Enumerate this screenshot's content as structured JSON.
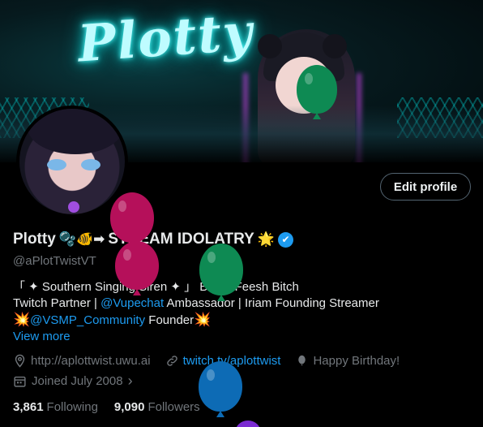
{
  "banner": {
    "neon_text": "Plotty"
  },
  "profile": {
    "edit_label": "Edit profile",
    "name": "Plotty",
    "name_emoji": "🫧🐠➡",
    "name_suffix": "STREAM IDOLATRY",
    "name_suffix_emoji": "🌟",
    "verified_mark": "✔",
    "handle": "@aPlotTwistVT"
  },
  "bio": {
    "line1": "「 ✦ Southern Singing Siren ✦ 」 Bratty Feesh Bitch",
    "line2_a": "Twitch Partner | ",
    "line2_link": "@Vupechat",
    "line2_b": " Ambassador | Iriam Founding Streamer",
    "line3_emoji_a": "💥",
    "line3_link": "@VSMP_Community",
    "line3_b": " Founder",
    "line3_emoji_b": "💥",
    "view_more": "View more"
  },
  "meta": {
    "website": "http://aplottwist.uwu.ai",
    "twitch": "twitch.tv/aplottwist",
    "birthday": "Happy Birthday!",
    "joined": "Joined July 2008",
    "chevron": "›"
  },
  "stats": {
    "following_count": "3,861",
    "following_label": "Following",
    "followers_count": "9,090",
    "followers_label": "Followers"
  },
  "colors": {
    "link": "#1d9bf0",
    "muted": "#71767b",
    "balloon_pink": "#b5105a",
    "balloon_green": "#0e8a53",
    "balloon_blue": "#0d6bb5"
  }
}
